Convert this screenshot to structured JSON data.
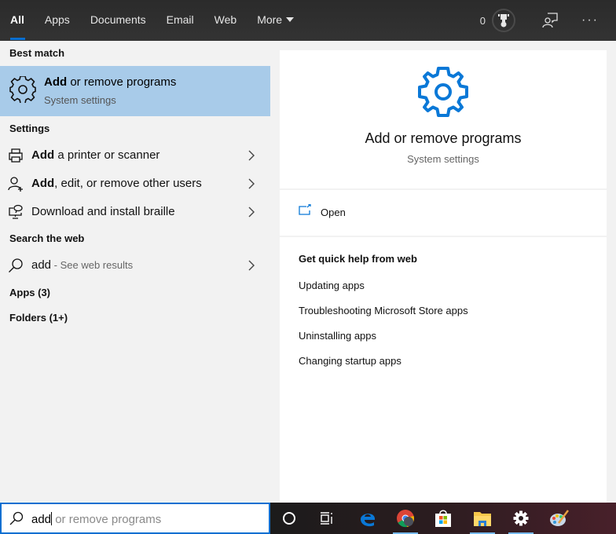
{
  "topbar": {
    "tabs": [
      {
        "label": "All",
        "active": true
      },
      {
        "label": "Apps"
      },
      {
        "label": "Documents"
      },
      {
        "label": "Email"
      },
      {
        "label": "Web"
      },
      {
        "label": "More"
      }
    ],
    "points": "0",
    "icons": [
      "trophy-icon",
      "feedback-icon",
      "more-options-icon"
    ],
    "more_dots": "···"
  },
  "left": {
    "best_match_header": "Best match",
    "best_match": {
      "title_bold": "Add",
      "title_rest": " or remove programs",
      "subtitle": "System settings",
      "icon": "gear-icon"
    },
    "settings_header": "Settings",
    "settings_items": [
      {
        "bold": "Add",
        "rest": " a printer or scanner",
        "icon": "printer-icon"
      },
      {
        "bold": "Add",
        "rest": ", edit, or remove other users",
        "icon": "add-user-icon"
      },
      {
        "bold": "",
        "rest": "Download and install braille",
        "icon": "braille-display-icon"
      }
    ],
    "web_header": "Search the web",
    "web_item": {
      "query": "add",
      "suffix": " - See web results",
      "icon": "search-icon"
    },
    "apps_label": "Apps (3)",
    "folders_label": "Folders (1+)"
  },
  "preview": {
    "title": "Add or remove programs",
    "subtitle": "System settings",
    "open_label": "Open",
    "help_header": "Get quick help from web",
    "help_links": [
      "Updating apps",
      "Troubleshooting Microsoft Store apps",
      "Uninstalling apps",
      "Changing startup apps"
    ]
  },
  "search": {
    "typed": "add",
    "suggestion": "or remove programs"
  },
  "taskbar": {
    "items": [
      {
        "name": "cortana",
        "running": false
      },
      {
        "name": "task-view",
        "running": false
      },
      {
        "name": "edge",
        "running": false
      },
      {
        "name": "chrome",
        "running": true
      },
      {
        "name": "microsoft-store",
        "running": false
      },
      {
        "name": "file-explorer",
        "running": true
      },
      {
        "name": "settings",
        "running": true
      },
      {
        "name": "paint",
        "running": false
      }
    ]
  },
  "colors": {
    "accent": "#0a6fd1",
    "selection": "#a8cbe9",
    "taskbar_indicator": "#76b9ed"
  }
}
